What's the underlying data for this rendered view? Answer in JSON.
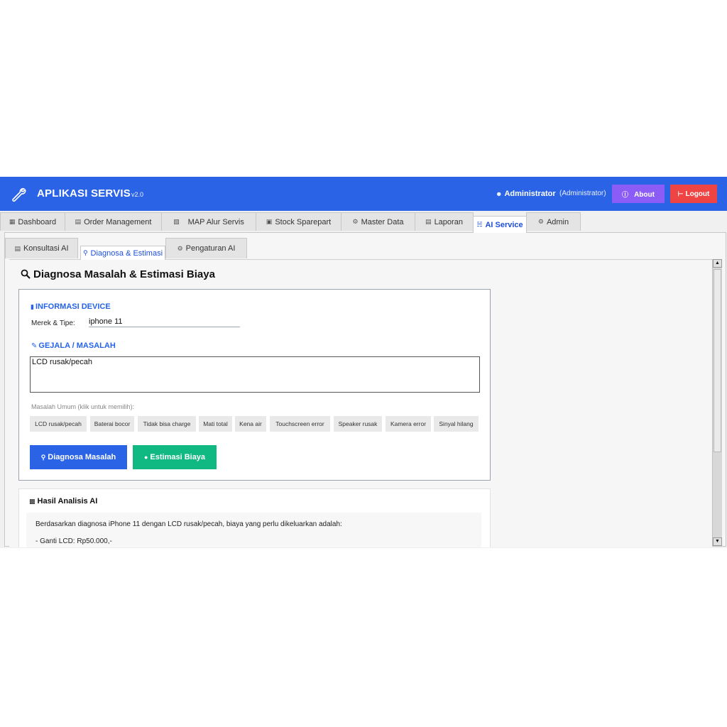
{
  "app": {
    "title": "APLIKASI SERVIS",
    "version": "v2.0",
    "user_name": "Administrator",
    "user_role": "(Administrator)",
    "about_label": "About",
    "logout_label": "Logout",
    "colors": {
      "brand": "#2b63e6",
      "about": "#8b5cf6",
      "logout": "#ef4444",
      "success": "#10b981"
    }
  },
  "main_tabs": [
    {
      "label": "Dashboard",
      "icon": "dashboard-icon"
    },
    {
      "label": "Order Management",
      "icon": "order-icon"
    },
    {
      "label": "MAP Alur Servis",
      "icon": "map-icon"
    },
    {
      "label": "Stock Sparepart",
      "icon": "box-icon"
    },
    {
      "label": "Master Data",
      "icon": "gear-icon"
    },
    {
      "label": "Laporan",
      "icon": "report-icon"
    },
    {
      "label": "AI Service",
      "icon": "robot-icon",
      "active": true
    },
    {
      "label": "Admin",
      "icon": "gear-icon"
    }
  ],
  "sub_tabs": [
    {
      "label": "Konsultasi AI",
      "icon": "chat-icon"
    },
    {
      "label": "Diagnosa & Estimasi",
      "icon": "search-icon",
      "active": true
    },
    {
      "label": "Pengaturan AI",
      "icon": "gear-icon"
    }
  ],
  "page": {
    "title": "Diagnosa Masalah & Estimasi Biaya",
    "device_section": "INFORMASI DEVICE",
    "brand_label": "Merek & Tipe:",
    "brand_value": "iphone 11",
    "symptom_section": "GEJALA / MASALAH",
    "symptom_value": "LCD rusak/pecah",
    "common_hint": "Masalah Umum (klik untuk memilih):",
    "common_issues": [
      "LCD rusak/pecah",
      "Baterai bocor",
      "Tidak bisa charge",
      "Mati total",
      "Kena air",
      "Touchscreen error",
      "Speaker rusak",
      "Kamera error",
      "Sinyal hilang"
    ],
    "diagnose_label": "Diagnosa Masalah",
    "estimate_label": "Estimasi Biaya"
  },
  "result": {
    "title": "Hasil Analisis AI",
    "lines": [
      "Berdasarkan diagnosa iPhone 11 dengan LCD rusak/pecah, biaya yang perlu dikeluarkan adalah:",
      "- Ganti LCD: Rp50.000,-"
    ]
  }
}
